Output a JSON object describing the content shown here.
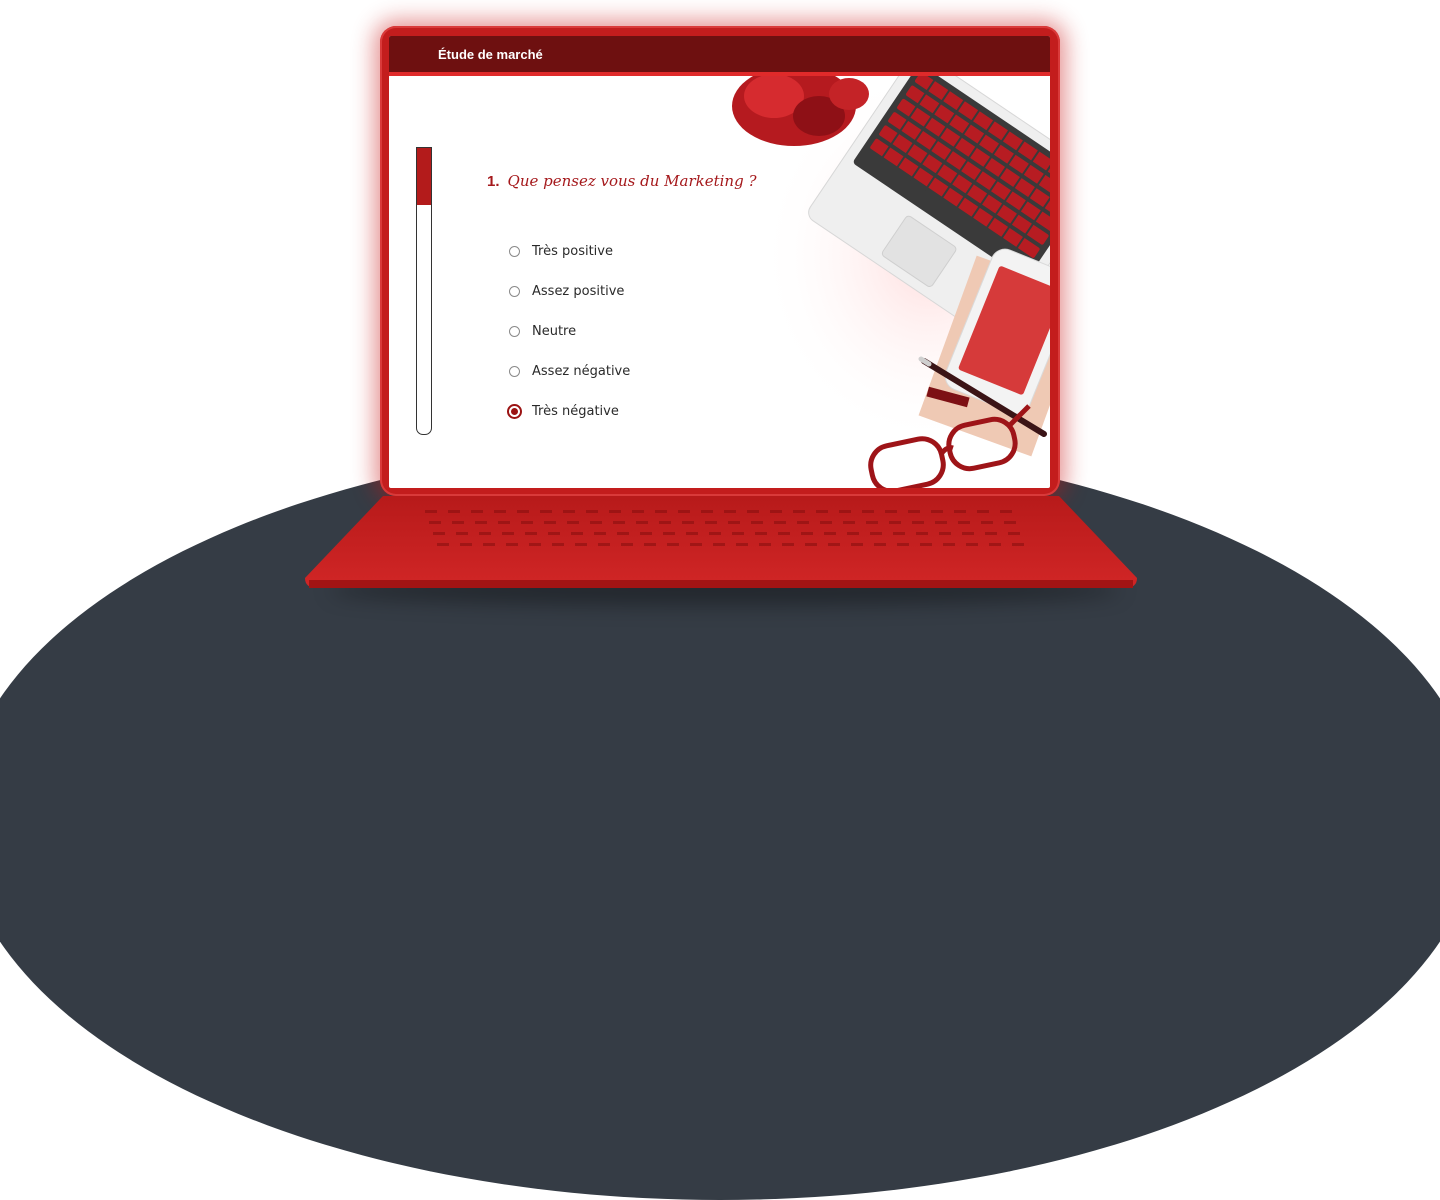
{
  "app": {
    "title": "Étude de marché"
  },
  "survey": {
    "progress": 0.2,
    "question": {
      "number": "1.",
      "text": "Que pensez vous du  Marketing ?"
    },
    "options": [
      {
        "label": "Très positive",
        "selected": false
      },
      {
        "label": "Assez positive",
        "selected": false
      },
      {
        "label": "Neutre",
        "selected": false
      },
      {
        "label": "Assez négative",
        "selected": false
      },
      {
        "label": "Très négative",
        "selected": true
      }
    ]
  },
  "colors": {
    "accent": "#a5191c",
    "laptop": "#c31d1d",
    "titlebar": "#6e1010",
    "backdrop": "#353c45"
  },
  "icons": [
    "laptop-illustration",
    "plant-icon",
    "phone-icon",
    "pen-icon",
    "glasses-icon",
    "keyboard-illustration"
  ]
}
